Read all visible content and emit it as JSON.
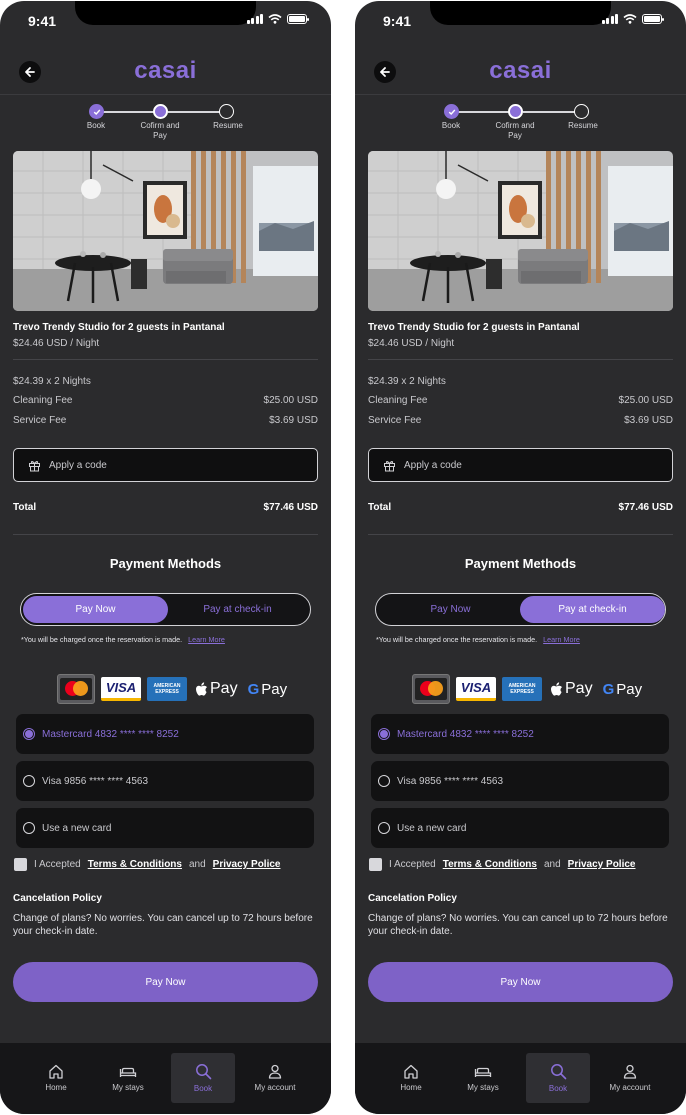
{
  "status_bar": {
    "time": "9:41"
  },
  "header": {
    "logo": "casai"
  },
  "stepper": {
    "steps": [
      {
        "line1": "Book",
        "line2": ""
      },
      {
        "line1": "Cofirm and",
        "line2": "Pay"
      },
      {
        "line1": "Resume",
        "line2": ""
      }
    ]
  },
  "listing": {
    "title": "Trevo Trendy Studio for 2 guests in Pantanal",
    "price_per_night": "$24.46 USD / Night"
  },
  "fees": {
    "nights_label": "$24.39 x 2 Nights",
    "nights_value": "",
    "cleaning_label": "Cleaning Fee",
    "cleaning_value": "$25.00 USD",
    "service_label": "Service Fee",
    "service_value": "$3.69 USD"
  },
  "promo": {
    "placeholder": "Apply a code"
  },
  "total": {
    "label": "Total",
    "value": "$77.46 USD"
  },
  "payment": {
    "title": "Payment Methods",
    "option_now": "Pay Now",
    "option_checkin": "Pay at check-in",
    "note": "*You will be charged once the reservation is made.",
    "learn_more": "Learn More",
    "brands": {
      "visa": "VISA",
      "amex_line1": "AMERICAN",
      "amex_line2": "EXPRESS",
      "apple_pay": "Pay",
      "google_g": "G",
      "google_pay": "Pay"
    },
    "cards": [
      {
        "label": "Mastercard 4832 **** **** 8252",
        "selected": true
      },
      {
        "label": "Visa 9856 **** **** 4563",
        "selected": false
      },
      {
        "label": "Use a new card",
        "selected": false
      }
    ]
  },
  "terms": {
    "prefix": "I Accepted",
    "terms_link": "Terms & Conditions",
    "and": "and",
    "privacy_link": "Privacy Police"
  },
  "cancelation": {
    "title": "Cancelation Policy",
    "text": "Change of plans? No worries. You can cancel up to 72 hours before your check-in date."
  },
  "cta": {
    "label": "Pay Now"
  },
  "nav": {
    "items": [
      {
        "label": "Home"
      },
      {
        "label": "My stays"
      },
      {
        "label": "Book"
      },
      {
        "label": "My account"
      }
    ]
  },
  "screens": [
    {
      "active_payment_option": "Pay Now"
    },
    {
      "active_payment_option": "Pay at check-in"
    }
  ],
  "colors": {
    "accent": "#8a6fd8",
    "background": "#2b2b2d",
    "nav_background": "#161618",
    "cta": "#7e62c7"
  }
}
